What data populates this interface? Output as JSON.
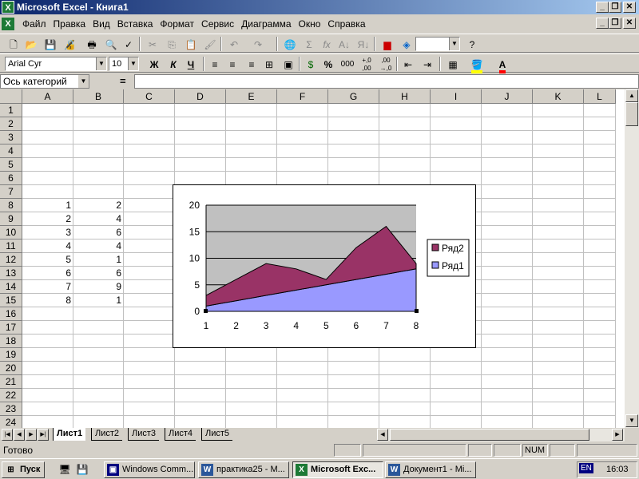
{
  "window": {
    "title": "Microsoft Excel - Книга1",
    "app_icon": "excel-icon"
  },
  "menubar": {
    "items": [
      "Файл",
      "Правка",
      "Вид",
      "Вставка",
      "Формат",
      "Сервис",
      "Диаграмма",
      "Окно",
      "Справка"
    ]
  },
  "toolbar_standard": {
    "buttons": [
      "new-icon",
      "open-icon",
      "save-icon",
      "permissions-icon",
      "print-icon",
      "print-preview-icon",
      "spelling-icon",
      "cut-icon",
      "copy-icon",
      "paste-icon",
      "format-painter-icon",
      "undo-icon",
      "redo-icon",
      "hyperlink-icon",
      "autosum-icon",
      "function-icon",
      "sort-asc-icon",
      "sort-desc-icon",
      "chart-wizard-icon",
      "drawing-icon",
      "help-icon"
    ]
  },
  "toolbar_format": {
    "font": "Arial Cyr",
    "size": "10",
    "bold": "Ж",
    "italic": "К",
    "underline": "Ч",
    "percent": "%",
    "thousands": "000",
    "inc_decimal": "+,0 ,00",
    "dec_decimal": ",00 →,0"
  },
  "formula_bar": {
    "name_box": "Ось категорий",
    "equals": "=",
    "value": ""
  },
  "sheet": {
    "columns": [
      "A",
      "B",
      "C",
      "D",
      "E",
      "F",
      "G",
      "H",
      "I",
      "J",
      "K",
      "L"
    ],
    "rows": [
      "1",
      "2",
      "3",
      "4",
      "5",
      "6",
      "7",
      "8",
      "9",
      "10",
      "11",
      "12",
      "13",
      "14",
      "15",
      "16",
      "17",
      "18",
      "19",
      "20",
      "21",
      "22",
      "23",
      "24"
    ],
    "data": [
      {
        "row": 8,
        "A": "1",
        "B": "2"
      },
      {
        "row": 9,
        "A": "2",
        "B": "4"
      },
      {
        "row": 10,
        "A": "3",
        "B": "6"
      },
      {
        "row": 11,
        "A": "4",
        "B": "4"
      },
      {
        "row": 12,
        "A": "5",
        "B": "1"
      },
      {
        "row": 13,
        "A": "6",
        "B": "6"
      },
      {
        "row": 14,
        "A": "7",
        "B": "9"
      },
      {
        "row": 15,
        "A": "8",
        "B": "1"
      }
    ]
  },
  "tabs": [
    "Лист1",
    "Лист2",
    "Лист3",
    "Лист4",
    "Лист5"
  ],
  "active_tab": "Лист1",
  "status": {
    "text": "Готово",
    "num": "NUM"
  },
  "taskbar": {
    "start": "Пуск",
    "windows": [
      "Windows Comm...",
      "практика25 - М...",
      "Microsoft Exc...",
      "Документ1 - Mi..."
    ],
    "active_window": "Microsoft Exc...",
    "lang": "EN",
    "time": "16:03"
  },
  "chart_data": {
    "type": "area",
    "stacked": true,
    "categories": [
      "1",
      "2",
      "3",
      "4",
      "5",
      "6",
      "7",
      "8"
    ],
    "series": [
      {
        "name": "Ряд1",
        "values": [
          1,
          2,
          3,
          4,
          5,
          6,
          7,
          8
        ],
        "color": "#9999ff"
      },
      {
        "name": "Ряд2",
        "values": [
          2,
          4,
          6,
          4,
          1,
          6,
          9,
          1
        ],
        "color": "#993366"
      }
    ],
    "ylim": [
      0,
      20
    ],
    "yticks": [
      "0",
      "5",
      "10",
      "15",
      "20"
    ],
    "plot_background": "#c0c0c0",
    "gridlines": true,
    "legend": "right"
  }
}
